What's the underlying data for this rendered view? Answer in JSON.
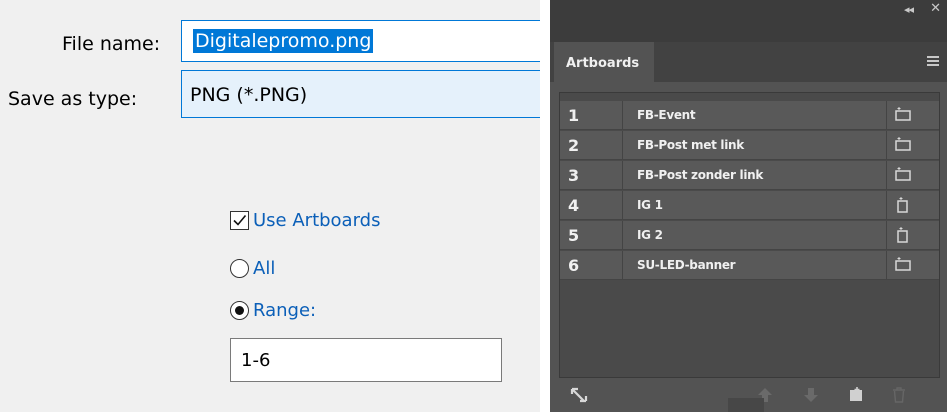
{
  "save_dialog": {
    "file_name_label": "File name:",
    "file_name_value": "Digitalepromo.png",
    "save_as_type_label": "Save as type:",
    "save_as_type_value": "PNG (*.PNG)",
    "use_artboards_label": "Use Artboards",
    "use_artboards_checked": true,
    "all_label": "All",
    "range_label": "Range:",
    "range_value": "1-6",
    "selected_option": "Range"
  },
  "artboards_panel": {
    "tab_label": "Artboards",
    "rows": [
      {
        "num": "1",
        "name": "FB-Event",
        "orientation": "landscape"
      },
      {
        "num": "2",
        "name": "FB-Post met link",
        "orientation": "landscape"
      },
      {
        "num": "3",
        "name": "FB-Post zonder link",
        "orientation": "landscape"
      },
      {
        "num": "4",
        "name": "IG 1",
        "orientation": "portrait"
      },
      {
        "num": "5",
        "name": "IG 2",
        "orientation": "portrait"
      },
      {
        "num": "6",
        "name": "SU-LED-banner",
        "orientation": "landscape"
      }
    ],
    "footer_icons": [
      "link-icon",
      "move-up-icon",
      "move-down-icon",
      "new-artboard-icon",
      "delete-icon"
    ],
    "colors": {
      "panel_bg": "#535353",
      "row_bg": "#595959",
      "text": "#f0f0f0"
    }
  }
}
